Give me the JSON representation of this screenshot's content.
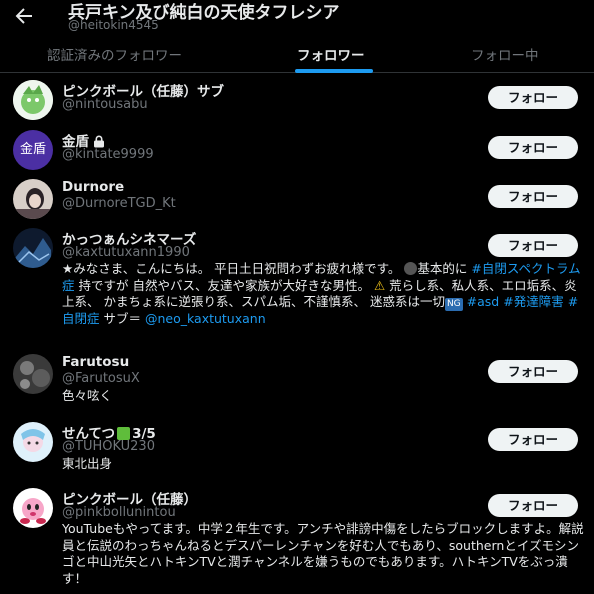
{
  "header": {
    "title": "兵戸キン及び純白の天使タフレシア",
    "handle": "@heitokin4545"
  },
  "tabs": [
    {
      "label": "認証済みのフォロワー"
    },
    {
      "label": "フォロワー"
    },
    {
      "label": "フォロー中"
    }
  ],
  "follow_label": "フォロー",
  "users": [
    {
      "name": "ピンクボール（任藤）サブ",
      "handle": "@nintousabu"
    },
    {
      "name": "金盾",
      "handle": "@kintate9999",
      "avatar_text": "金盾"
    },
    {
      "name": "Durnore",
      "handle": "@DurnoreTGD_Kt"
    },
    {
      "name": "かっつぁんシネマーズ",
      "handle": "@kaxtutuxann1990",
      "bio": {
        "t1": "★みなさま、こんにちは。 平日土日祝問わずお疲れ様です。",
        "t2": "基本的に",
        "tag1": "#自閉スペクトラム症",
        "t3": "持ですが 自然やバス、友達や家族が大好きな男性。",
        "t4": "荒らし系、私人系、エロ垢系、炎上系、 かまちょ系に逆張り系、スパム垢、不謹慎系、 迷惑系は一切",
        "ng": "NG",
        "tag2": "#asd",
        "tag3": "#発達障害",
        "tag4": "#自閉症",
        "t5": "サブ＝",
        "mention": "@neo_kaxtutuxann"
      }
    },
    {
      "name": "Farutosu",
      "handle": "@FarutosuX",
      "bio_text": "色々呟く"
    },
    {
      "name": "せんてつ",
      "name_suffix": "3/5",
      "handle": "@TUHOKU230",
      "bio_text": "東北出身"
    },
    {
      "name": "ピンクボール（任藤）",
      "handle": "@pinkbollunintou",
      "bio_text": "YouTubeもやってます。中学２年生です。アンチや誹謗中傷をしたらブロックしますよ。解説員と伝説のわっちゃんねるとデスパーレンチャンを好む人でもあり、southernとイズモシンゴと中山光矢とハトキンTVと潤チャンネルを嫌うものでもあります。ハトキンTVをぶっ潰す！"
    }
  ]
}
